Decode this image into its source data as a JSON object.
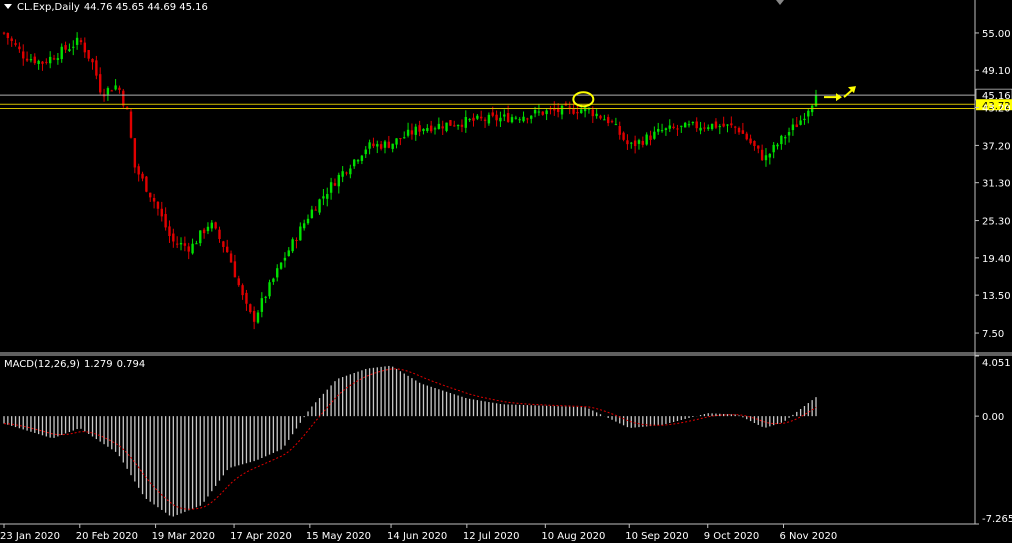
{
  "header": {
    "symbol": "CL.Exp,Daily",
    "ohlc": "44.76 45.65 44.69 45.16"
  },
  "macd": {
    "label": "MACD(12,26,9)",
    "value": "1.279",
    "signal": "0.794",
    "axis_labels": [
      "4.051",
      "0.00",
      "-7.265"
    ]
  },
  "price_axis": {
    "labels": [
      "55.00",
      "49.10",
      "43.20",
      "37.20",
      "31.30",
      "25.30",
      "19.40",
      "13.50",
      "7.50"
    ],
    "current_price": "45.16",
    "level_price": "43.72",
    "level_hidden": "43.20"
  },
  "time_axis": {
    "labels": [
      "23 Jan 2020",
      "20 Feb 2020",
      "19 Mar 2020",
      "17 Apr 2020",
      "15 May 2020",
      "14 Jun 2020",
      "12 Jul 2020",
      "10 Aug 2020",
      "10 Sep 2020",
      "9 Oct 2020",
      "6 Nov 2020"
    ]
  },
  "colors": {
    "background": "#000000",
    "bull_candle": "#00e000",
    "bear_candle": "#e00000",
    "level_line": "#d4c000",
    "current_line": "#b0b0b0",
    "macd_hist": "#c8c8c8",
    "macd_signal": "#e00000",
    "annotation": "#ffff00",
    "axis": "#c0c0c0"
  },
  "chart_data": [
    {
      "type": "candlestick",
      "title": "CL.Exp,Daily",
      "x_range": [
        "23 Jan 2020",
        "18 Nov 2020"
      ],
      "ylim": [
        4.5,
        58.0
      ],
      "close_path": [
        [
          "23 Jan 2020",
          55.0
        ],
        [
          "30 Jan 2020",
          51.5
        ],
        [
          "6 Feb 2020",
          50.3
        ],
        [
          "13 Feb 2020",
          52.0
        ],
        [
          "20 Feb 2020",
          53.8
        ],
        [
          "25 Feb 2020",
          50.0
        ],
        [
          "28 Feb 2020",
          45.5
        ],
        [
          "5 Mar 2020",
          46.8
        ],
        [
          "9 Mar 2020",
          41.8
        ],
        [
          "11 Mar 2020",
          34.0
        ],
        [
          "19 Mar 2020",
          28.0
        ],
        [
          "25 Mar 2020",
          22.0
        ],
        [
          "1 Apr 2020",
          21.0
        ],
        [
          "8 Apr 2020",
          25.0
        ],
        [
          "15 Apr 2020",
          20.0
        ],
        [
          "21 Apr 2020",
          12.0
        ],
        [
          "24 Apr 2020",
          9.5
        ],
        [
          "28 Apr 2020",
          13.0
        ],
        [
          "5 May 2020",
          19.0
        ],
        [
          "15 May 2020",
          26.5
        ],
        [
          "25 May 2020",
          32.0
        ],
        [
          "5 Jun 2020",
          37.0
        ],
        [
          "14 Jun 2020",
          37.5
        ],
        [
          "25 Jun 2020",
          40.0
        ],
        [
          "12 Jul 2020",
          41.0
        ],
        [
          "25 Jul 2020",
          41.5
        ],
        [
          "10 Aug 2020",
          42.5
        ],
        [
          "25 Aug 2020",
          43.0
        ],
        [
          "3 Sep 2020",
          41.0
        ],
        [
          "10 Sep 2020",
          37.0
        ],
        [
          "22 Sep 2020",
          39.5
        ],
        [
          "9 Oct 2020",
          40.5
        ],
        [
          "20 Oct 2020",
          40.0
        ],
        [
          "30 Oct 2020",
          35.0
        ],
        [
          "6 Nov 2020",
          38.5
        ],
        [
          "12 Nov 2020",
          41.0
        ],
        [
          "18 Nov 2020",
          45.16
        ]
      ],
      "horizontal_levels": [
        43.72,
        43.2
      ],
      "current_price": 45.16,
      "annotations": [
        "yellow ellipse near 10 Aug 2020 top at 43.72",
        "yellow arrows pointing up-right after last candle"
      ]
    },
    {
      "type": "bar",
      "title": "MACD(12,26,9)",
      "ylim": [
        -7.265,
        4.051
      ],
      "series": [
        {
          "name": "MACD",
          "path": [
            [
              "23 Jan 2020",
              -0.5
            ],
            [
              "10 Feb 2020",
              -1.5
            ],
            [
              "20 Feb 2020",
              -0.8
            ],
            [
              "5 Mar 2020",
              -2.5
            ],
            [
              "15 Mar 2020",
              -5.5
            ],
            [
              "25 Mar 2020",
              -6.8
            ],
            [
              "5 Apr 2020",
              -6.0
            ],
            [
              "15 Apr 2020",
              -3.5
            ],
            [
              "25 Apr 2020",
              -3.0
            ],
            [
              "5 May 2020",
              -2.2
            ],
            [
              "15 May 2020",
              0.5
            ],
            [
              "25 May 2020",
              2.5
            ],
            [
              "5 Jun 2020",
              3.2
            ],
            [
              "14 Jun 2020",
              3.4
            ],
            [
              "25 Jun 2020",
              2.2
            ],
            [
              "12 Jul 2020",
              1.2
            ],
            [
              "25 Jul 2020",
              0.8
            ],
            [
              "10 Aug 2020",
              0.7
            ],
            [
              "25 Aug 2020",
              0.6
            ],
            [
              "10 Sep 2020",
              -0.8
            ],
            [
              "22 Sep 2020",
              -0.6
            ],
            [
              "9 Oct 2020",
              0.2
            ],
            [
              "20 Oct 2020",
              0.1
            ],
            [
              "30 Oct 2020",
              -0.8
            ],
            [
              "6 Nov 2020",
              -0.4
            ],
            [
              "18 Nov 2020",
              1.279
            ]
          ]
        },
        {
          "name": "Signal",
          "value_last": 0.794
        }
      ]
    }
  ]
}
